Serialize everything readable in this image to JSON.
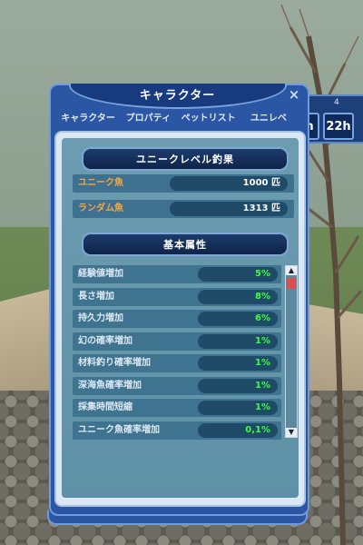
{
  "window": {
    "title": "キャラクター",
    "close_symbol": "×",
    "tabs": [
      "キャラクター",
      "プロパティ",
      "ペットリスト",
      "ユニレベ"
    ]
  },
  "time_panel": {
    "number": "4",
    "buttons": [
      "h",
      "22h"
    ]
  },
  "fishing_result": {
    "header": "ユニークレベル釣果",
    "rows": [
      {
        "label": "ユニーク魚",
        "value": "1000 匹"
      },
      {
        "label": "ランダム魚",
        "value": "1313 匹"
      }
    ]
  },
  "attributes": {
    "header": "基本属性",
    "rows": [
      {
        "label": "経験値増加",
        "value": "5%"
      },
      {
        "label": "長さ増加",
        "value": "8%"
      },
      {
        "label": "持久力増加",
        "value": "6%"
      },
      {
        "label": "幻の確率増加",
        "value": "1%"
      },
      {
        "label": "材料釣り確率増加",
        "value": "1%"
      },
      {
        "label": "深海魚確率増加",
        "value": "1%"
      },
      {
        "label": "採集時間短縮",
        "value": "1%"
      },
      {
        "label": "ユニーク魚確率増加",
        "value": "0,1%"
      }
    ]
  },
  "scrollbar": {
    "up": "▲",
    "down": "▼"
  },
  "colors": {
    "window_blue": "#2a56a3",
    "fish_label": "#f4a640",
    "attr_value": "#3cff3c",
    "scroll_thumb": "#d85050"
  }
}
